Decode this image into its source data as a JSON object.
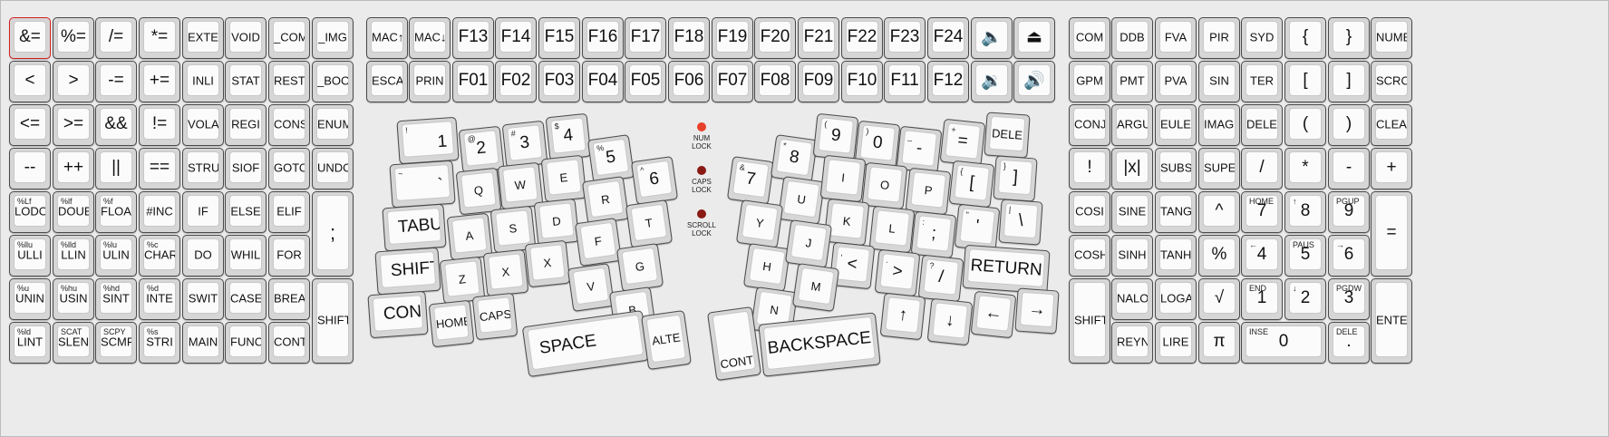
{
  "colors": {
    "accent_highlight": "#d62020",
    "num_lock_led": "#e8402a",
    "caps_lock_led": "#8a1a14",
    "scroll_lock_led": "#8a1a14"
  },
  "left_block": [
    [
      {
        "label": "&="
      },
      {
        "label": "%="
      },
      {
        "label": "/="
      },
      {
        "label": "*="
      },
      {
        "label": "EXTE"
      },
      {
        "label": "VOID"
      },
      {
        "label": "_COM"
      },
      {
        "label": "_IMG"
      }
    ],
    [
      {
        "label": "<"
      },
      {
        "label": ">"
      },
      {
        "label": "-="
      },
      {
        "label": "+="
      },
      {
        "label": "INLI"
      },
      {
        "label": "STAT"
      },
      {
        "label": "REST"
      },
      {
        "label": "_BOO"
      }
    ],
    [
      {
        "label": "<="
      },
      {
        "label": ">="
      },
      {
        "label": "&&"
      },
      {
        "label": "!="
      },
      {
        "label": "VOLA"
      },
      {
        "label": "REGI"
      },
      {
        "label": "CONS"
      },
      {
        "label": "ENUM"
      }
    ],
    [
      {
        "label": "--"
      },
      {
        "label": "++"
      },
      {
        "label": "||"
      },
      {
        "label": "=="
      },
      {
        "label": "STRU"
      },
      {
        "label": "SIOF"
      },
      {
        "label": "GOTO"
      },
      {
        "label": "UNDO"
      }
    ],
    [
      {
        "label": "LODO",
        "sub": "%Lf"
      },
      {
        "label": "DOUB",
        "sub": "%lf"
      },
      {
        "label": "FLOA",
        "sub": "%f"
      },
      {
        "label": "#INC"
      },
      {
        "label": "IF"
      },
      {
        "label": "ELSE"
      },
      {
        "label": "ELIF"
      }
    ],
    [
      {
        "label": "ULLI",
        "sub": "%llu"
      },
      {
        "label": "LLIN",
        "sub": "%lld"
      },
      {
        "label": "ULIN",
        "sub": "%lu"
      },
      {
        "label": "CHAR",
        "sub": "%c"
      },
      {
        "label": "DO"
      },
      {
        "label": "WHIL"
      },
      {
        "label": "FOR"
      }
    ],
    [
      {
        "label": "UNIN",
        "sub": "%u"
      },
      {
        "label": "USIN",
        "sub": "%hu"
      },
      {
        "label": "SINT",
        "sub": "%hd"
      },
      {
        "label": "INTE",
        "sub": "%d"
      },
      {
        "label": "SWIT"
      },
      {
        "label": "CASE"
      },
      {
        "label": "BREA"
      }
    ],
    [
      {
        "label": "LINT",
        "sub": "%ld"
      },
      {
        "label": "SLEN",
        "sub": "SCAT"
      },
      {
        "label": "SCMP",
        "sub": "SCPY"
      },
      {
        "label": "STRI",
        "sub": "%s"
      },
      {
        "label": "MAIN"
      },
      {
        "label": "FUNC"
      },
      {
        "label": "CONT"
      }
    ]
  ],
  "left_tall": {
    "semicolon": ";",
    "shift": "SHIFT"
  },
  "fn_row1": [
    "MAC↑",
    "MAC↓",
    "F13",
    "F14",
    "F15",
    "F16",
    "F17",
    "F18",
    "F19",
    "F20",
    "F21",
    "F22",
    "F23",
    "F24",
    "🔈",
    "⏏"
  ],
  "fn_row2": [
    "ESCA",
    "PRIN",
    "F01",
    "F02",
    "F03",
    "F04",
    "F05",
    "F06",
    "F07",
    "F08",
    "F09",
    "F10",
    "F11",
    "F12",
    "🔉",
    "🔊"
  ],
  "left_alpha": [
    {
      "label": "1",
      "sub": "!"
    },
    {
      "label": "2",
      "sub": "@"
    },
    {
      "label": "3",
      "sub": "#"
    },
    {
      "label": "4",
      "sub": "$"
    },
    {
      "label": "5",
      "sub": "%"
    },
    {
      "label": "6",
      "sub": "^"
    },
    {
      "label": "`",
      "sub": "~"
    },
    {
      "label": "Q"
    },
    {
      "label": "W"
    },
    {
      "label": "E"
    },
    {
      "label": "R"
    },
    {
      "label": "T"
    },
    {
      "label": "TABU"
    },
    {
      "label": "A"
    },
    {
      "label": "S"
    },
    {
      "label": "D"
    },
    {
      "label": "F"
    },
    {
      "label": "G"
    },
    {
      "label": "SHIFT"
    },
    {
      "label": "Z"
    },
    {
      "label": "X"
    },
    {
      "label": "X"
    },
    {
      "label": "V"
    },
    {
      "label": "B"
    },
    {
      "label": "CONT"
    },
    {
      "label": "HOME"
    },
    {
      "label": "CAPS"
    },
    {
      "label": "SPACE"
    },
    {
      "label": "ALTE"
    }
  ],
  "indicators": [
    {
      "label": "NUM\nLOCK"
    },
    {
      "label": "CAPS\nLOCK"
    },
    {
      "label": "SCROLL\nLOCK"
    }
  ],
  "right_alpha": [
    {
      "label": "7",
      "sub": "&"
    },
    {
      "label": "8",
      "sub": "*"
    },
    {
      "label": "9",
      "sub": "("
    },
    {
      "label": "0",
      "sub": ")"
    },
    {
      "label": "-",
      "sub": "_"
    },
    {
      "label": "=",
      "sub": "+"
    },
    {
      "label": "DELE"
    },
    {
      "label": "U"
    },
    {
      "label": "I"
    },
    {
      "label": "O"
    },
    {
      "label": "P"
    },
    {
      "label": "[",
      "sub": "{"
    },
    {
      "label": "]",
      "sub": "}"
    },
    {
      "label": "Y"
    },
    {
      "label": "K"
    },
    {
      "label": "L"
    },
    {
      "label": ";",
      "sub": ":"
    },
    {
      "label": "'",
      "sub": "\""
    },
    {
      "label": "\\",
      "sub": "|"
    },
    {
      "label": "H"
    },
    {
      "label": "J"
    },
    {
      "label": "<",
      "sub": ","
    },
    {
      "label": ">",
      "sub": "."
    },
    {
      "label": "/",
      "sub": "?"
    },
    {
      "label": "RETURN"
    },
    {
      "label": "N"
    },
    {
      "label": "M"
    },
    {
      "label": "↑"
    },
    {
      "label": "↓"
    },
    {
      "label": "←"
    },
    {
      "label": "→"
    },
    {
      "label": "CONT"
    },
    {
      "label": "BACKSPACE"
    }
  ],
  "right_block": [
    [
      {
        "label": "COM"
      },
      {
        "label": "DDB"
      },
      {
        "label": "FVA"
      },
      {
        "label": "PIR"
      },
      {
        "label": "SYD"
      },
      {
        "label": "{"
      },
      {
        "label": "}"
      },
      {
        "label": "NUMB"
      }
    ],
    [
      {
        "label": "GPM"
      },
      {
        "label": "PMT"
      },
      {
        "label": "PVA"
      },
      {
        "label": "SIN"
      },
      {
        "label": "TER"
      },
      {
        "label": "["
      },
      {
        "label": "]"
      },
      {
        "label": "SCRO"
      }
    ],
    [
      {
        "label": "CONJ"
      },
      {
        "label": "ARGU"
      },
      {
        "label": "EULE"
      },
      {
        "label": "IMAGI"
      },
      {
        "label": "DELE"
      },
      {
        "label": "("
      },
      {
        "label": ")"
      },
      {
        "label": "CLEA"
      }
    ],
    [
      {
        "label": "!"
      },
      {
        "label": "|x|"
      },
      {
        "label": "SUBS"
      },
      {
        "label": "SUPE"
      },
      {
        "label": "/"
      },
      {
        "label": "*"
      },
      {
        "label": "-"
      },
      {
        "label": "+"
      }
    ],
    [
      {
        "label": "COSI"
      },
      {
        "label": "SINE"
      },
      {
        "label": "TANG"
      },
      {
        "label": "^"
      },
      {
        "label": "7",
        "sub": "HOME"
      },
      {
        "label": "8",
        "sub": "↑"
      },
      {
        "label": "9",
        "sub": "PGUP"
      }
    ],
    [
      {
        "label": "COSH"
      },
      {
        "label": "SINH"
      },
      {
        "label": "TANH"
      },
      {
        "label": "%"
      },
      {
        "label": "4",
        "sub": "←"
      },
      {
        "label": "5",
        "sub": "PAUS"
      },
      {
        "label": "6",
        "sub": "→"
      }
    ],
    [
      {
        "label": "NALO"
      },
      {
        "label": "LOGA"
      },
      {
        "label": "√"
      },
      {
        "label": "1",
        "sub": "END"
      },
      {
        "label": "2",
        "sub": "↓"
      },
      {
        "label": "3",
        "sub": "PGDW"
      }
    ],
    [
      {
        "label": "REYN"
      },
      {
        "label": "LIRE"
      },
      {
        "label": "π"
      },
      {
        "label": "0",
        "sub": "INSE"
      },
      {
        "label": ".",
        "sub": "DELE"
      }
    ]
  ],
  "right_tall": {
    "equals": "=",
    "shift": "SHIFT",
    "enter": "ENTE"
  }
}
